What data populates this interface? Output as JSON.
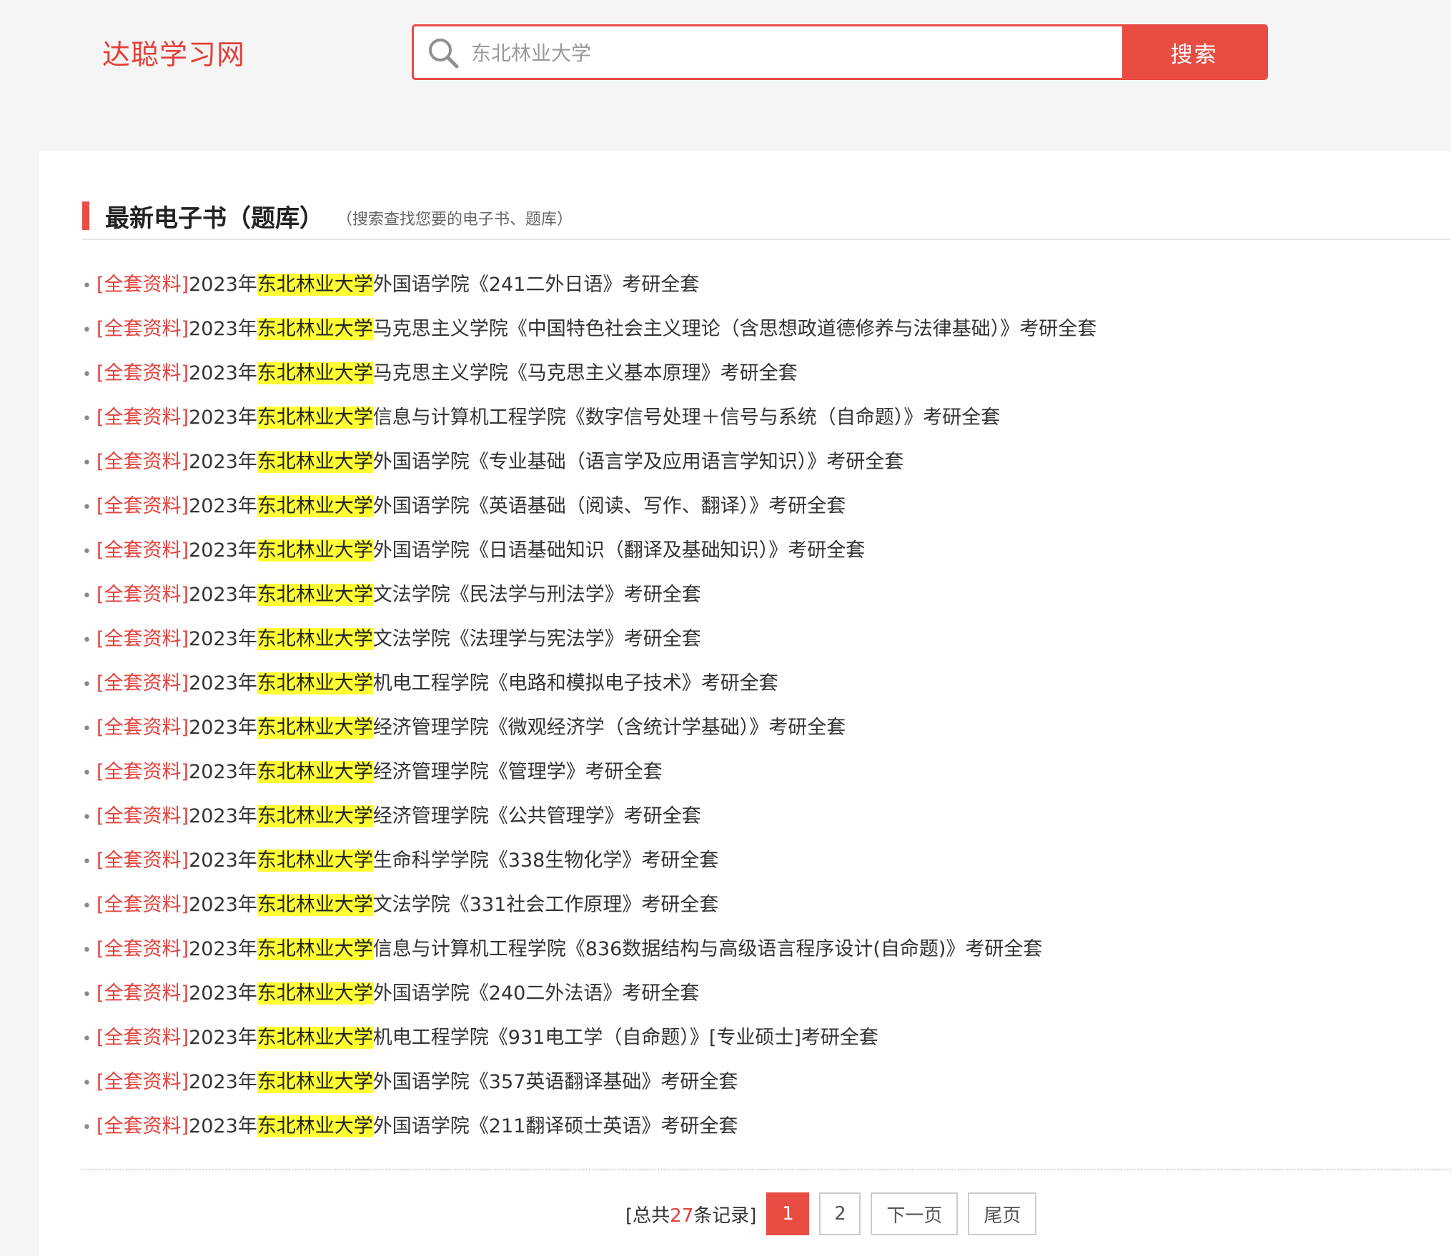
{
  "header": {
    "logo": "达聪学习网",
    "search": {
      "value": "东北林业大学",
      "button_label": "搜索"
    }
  },
  "section": {
    "title": "最新电子书（题库）",
    "subtitle": "（搜索查找您要的电子书、题库）"
  },
  "results": [
    {
      "tag": "[全套资料]",
      "year": "2023年",
      "school": "东北林业大学",
      "rest": "外国语学院《241二外日语》考研全套"
    },
    {
      "tag": "[全套资料]",
      "year": "2023年",
      "school": "东北林业大学",
      "rest": "马克思主义学院《中国特色社会主义理论（含思想政道德修养与法律基础）》考研全套"
    },
    {
      "tag": "[全套资料]",
      "year": "2023年",
      "school": "东北林业大学",
      "rest": "马克思主义学院《马克思主义基本原理》考研全套"
    },
    {
      "tag": "[全套资料]",
      "year": "2023年",
      "school": "东北林业大学",
      "rest": "信息与计算机工程学院《数字信号处理＋信号与系统（自命题）》考研全套"
    },
    {
      "tag": "[全套资料]",
      "year": "2023年",
      "school": "东北林业大学",
      "rest": "外国语学院《专业基础（语言学及应用语言学知识）》考研全套"
    },
    {
      "tag": "[全套资料]",
      "year": "2023年",
      "school": "东北林业大学",
      "rest": "外国语学院《英语基础（阅读、写作、翻译）》考研全套"
    },
    {
      "tag": "[全套资料]",
      "year": "2023年",
      "school": "东北林业大学",
      "rest": "外国语学院《日语基础知识（翻译及基础知识）》考研全套"
    },
    {
      "tag": "[全套资料]",
      "year": "2023年",
      "school": "东北林业大学",
      "rest": "文法学院《民法学与刑法学》考研全套"
    },
    {
      "tag": "[全套资料]",
      "year": "2023年",
      "school": "东北林业大学",
      "rest": "文法学院《法理学与宪法学》考研全套"
    },
    {
      "tag": "[全套资料]",
      "year": "2023年",
      "school": "东北林业大学",
      "rest": "机电工程学院《电路和模拟电子技术》考研全套"
    },
    {
      "tag": "[全套资料]",
      "year": "2023年",
      "school": "东北林业大学",
      "rest": "经济管理学院《微观经济学（含统计学基础）》考研全套"
    },
    {
      "tag": "[全套资料]",
      "year": "2023年",
      "school": "东北林业大学",
      "rest": "经济管理学院《管理学》考研全套"
    },
    {
      "tag": "[全套资料]",
      "year": "2023年",
      "school": "东北林业大学",
      "rest": "经济管理学院《公共管理学》考研全套"
    },
    {
      "tag": "[全套资料]",
      "year": "2023年",
      "school": "东北林业大学",
      "rest": "生命科学学院《338生物化学》考研全套"
    },
    {
      "tag": "[全套资料]",
      "year": "2023年",
      "school": "东北林业大学",
      "rest": "文法学院《331社会工作原理》考研全套"
    },
    {
      "tag": "[全套资料]",
      "year": "2023年",
      "school": "东北林业大学",
      "rest": "信息与计算机工程学院《836数据结构与高级语言程序设计(自命题)》考研全套"
    },
    {
      "tag": "[全套资料]",
      "year": "2023年",
      "school": "东北林业大学",
      "rest": "外国语学院《240二外法语》考研全套"
    },
    {
      "tag": "[全套资料]",
      "year": "2023年",
      "school": "东北林业大学",
      "rest": "机电工程学院《931电工学（自命题）》[专业硕士]考研全套"
    },
    {
      "tag": "[全套资料]",
      "year": "2023年",
      "school": "东北林业大学",
      "rest": "外国语学院《357英语翻译基础》考研全套"
    },
    {
      "tag": "[全套资料]",
      "year": "2023年",
      "school": "东北林业大学",
      "rest": "外国语学院《211翻译硕士英语》考研全套"
    }
  ],
  "pagination": {
    "total_prefix": "[总共",
    "total_count": "27",
    "total_suffix": "条记录]",
    "pages": [
      "1",
      "2"
    ],
    "current_page": "1",
    "next_label": "下一页",
    "last_label": "尾页"
  },
  "colors": {
    "accent": "#e84c43",
    "highlight": "#ffff33"
  },
  "icons": {
    "search": "search-icon"
  }
}
